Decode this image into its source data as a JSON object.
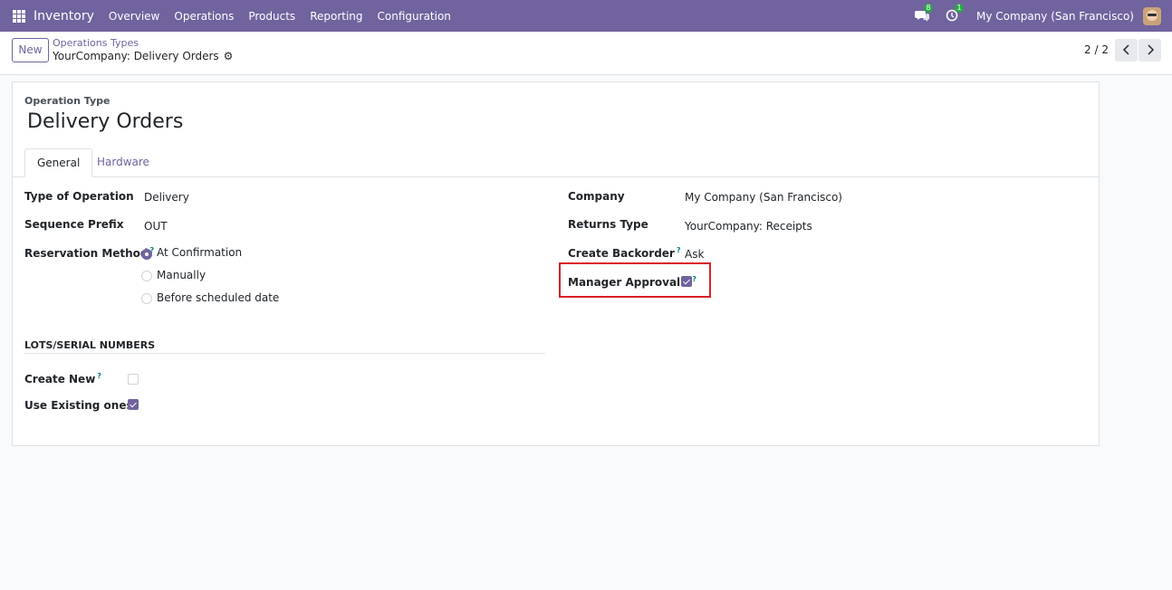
{
  "navbar": {
    "app_name": "Inventory",
    "menu": [
      "Overview",
      "Operations",
      "Products",
      "Reporting",
      "Configuration"
    ],
    "messages_badge": "8",
    "activities_badge": "1",
    "company": "My Company (San Francisco)"
  },
  "control_panel": {
    "new_label": "New",
    "breadcrumb_parent": "Operations Types",
    "breadcrumb_current": "YourCompany: Delivery Orders",
    "pager": "2 / 2"
  },
  "form": {
    "label": "Operation Type",
    "title": "Delivery Orders",
    "tabs": [
      "General",
      "Hardware"
    ],
    "left": {
      "type_of_operation_label": "Type of Operation",
      "type_of_operation_value": "Delivery",
      "sequence_prefix_label": "Sequence Prefix",
      "sequence_prefix_value": "OUT",
      "reservation_method_label": "Reservation Method",
      "reservation_options": [
        "At Confirmation",
        "Manually",
        "Before scheduled date"
      ],
      "reservation_selected": "At Confirmation"
    },
    "right": {
      "company_label": "Company",
      "company_value": "My Company (San Francisco)",
      "returns_type_label": "Returns Type",
      "returns_type_value": "YourCompany: Receipts",
      "create_backorder_label": "Create Backorder",
      "create_backorder_value": "Ask",
      "manager_approval_label": "Manager Approval ?",
      "manager_approval_checked": true
    },
    "lots": {
      "section_title": "LOTS/SERIAL NUMBERS",
      "create_new_label": "Create New",
      "create_new_checked": false,
      "use_existing_label": "Use Existing ones",
      "use_existing_checked": true
    },
    "help_mark": "?"
  },
  "colors": {
    "navbar": "#71639e",
    "accent": "#71639e",
    "help": "#017e84",
    "highlight": "#d92027"
  }
}
